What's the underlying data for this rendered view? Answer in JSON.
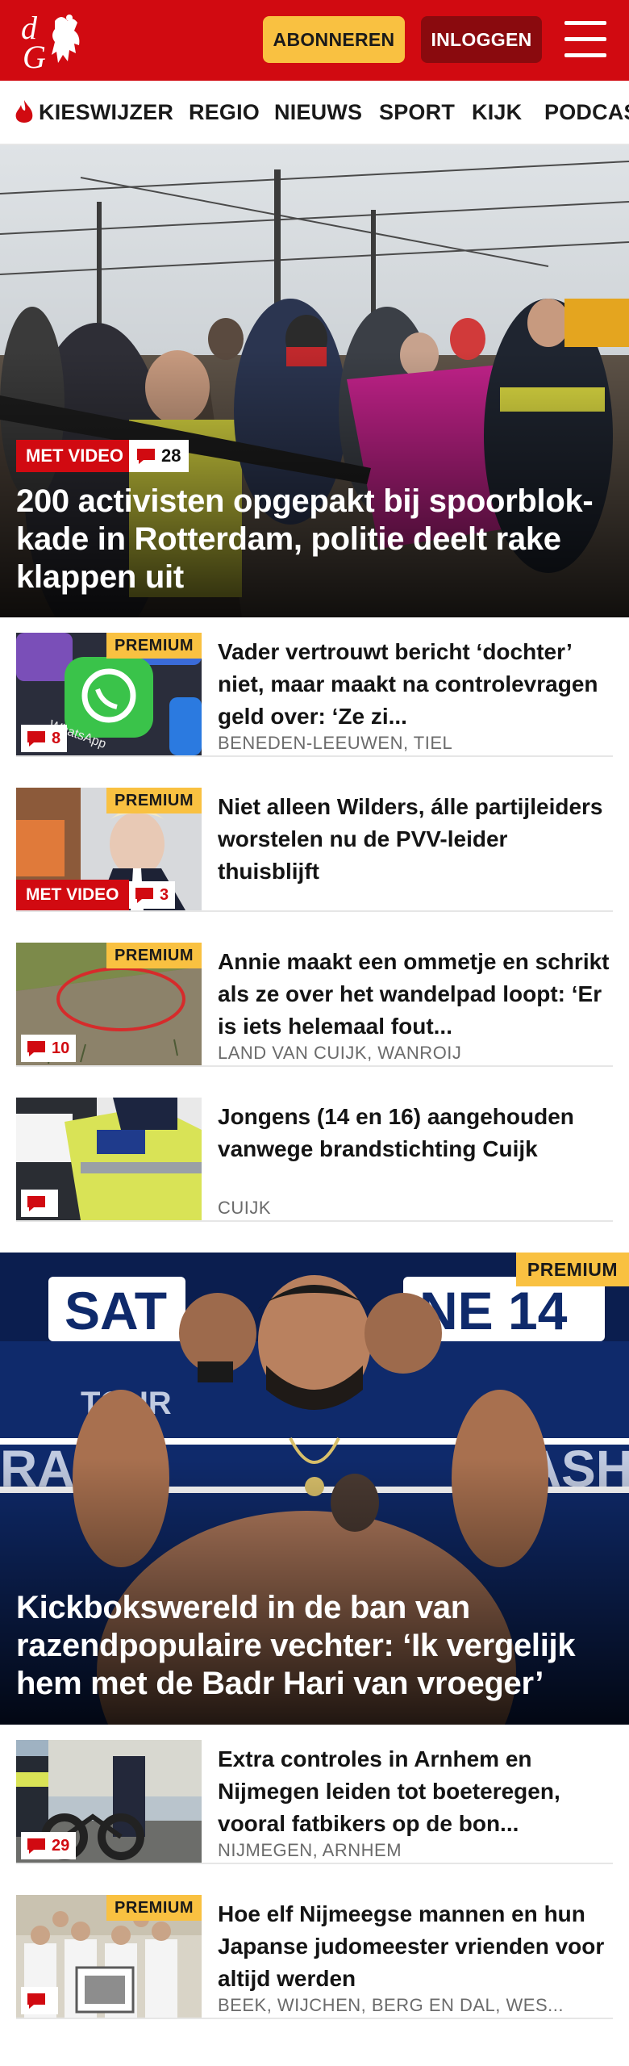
{
  "header": {
    "subscribe_label": "ABONNEREN",
    "login_label": "INLOGGEN",
    "brand_color": "#d10a11"
  },
  "nav": {
    "items": [
      {
        "label": "KIESWIJZER",
        "icon": "flame-icon"
      },
      {
        "label": "REGIO"
      },
      {
        "label": "NIEUWS"
      },
      {
        "label": "SPORT"
      },
      {
        "label": "KIJK"
      },
      {
        "label": "PODCAS"
      }
    ]
  },
  "hero": {
    "video_label": "MET VIDEO",
    "comments": "28",
    "title": "200 activisten opgepakt bij spoorblok­kade in Rotterdam, politie deelt rake klappen uit"
  },
  "articles": [
    {
      "premium": "PREMIUM",
      "comments": "8",
      "title": "Vader vertrouwt bericht ‘dochter’ niet, maar maakt na controlevragen geld over: ‘Ze zi...",
      "location": "BENEDEN-LEEUWEN, TIEL"
    },
    {
      "premium": "PREMIUM",
      "video_label": "MET VIDEO",
      "comments": "3",
      "title": "Niet alleen Wilders, álle partijlei­ders worstelen nu de PVV-leider thuisblijft",
      "location": ""
    },
    {
      "premium": "PREMIUM",
      "comments": "10",
      "title": "Annie maakt een ommetje en schrikt als ze over het wandelpad loopt: ‘Er is iets helemaal fout...",
      "location": "LAND VAN CUIJK, WANROIJ"
    },
    {
      "comments": "",
      "title": "Jongens (14 en 16) aangehouden vanwege brandstichting Cuijk",
      "location": "CUIJK"
    }
  ],
  "feature": {
    "premium": "PREMIUM",
    "title": "Kickbokswereld in de ban van razendpopulaire vechter: ‘Ik vergelijk hem met de Badr Hari van vroeger’"
  },
  "articles2": [
    {
      "comments": "29",
      "title": "Extra controles in Arnhem en Nijmegen leiden tot boeteregen, vooral fatbikers op de bon...",
      "location": "NIJMEGEN, ARNHEM"
    },
    {
      "premium": "PREMIUM",
      "comments": "",
      "title": "Hoe elf Nijmeegse mannen en hun Japanse judomeester vrienden voor altijd werden",
      "location": "BEEK, WIJCHEN, BERG EN DAL, WES..."
    }
  ]
}
